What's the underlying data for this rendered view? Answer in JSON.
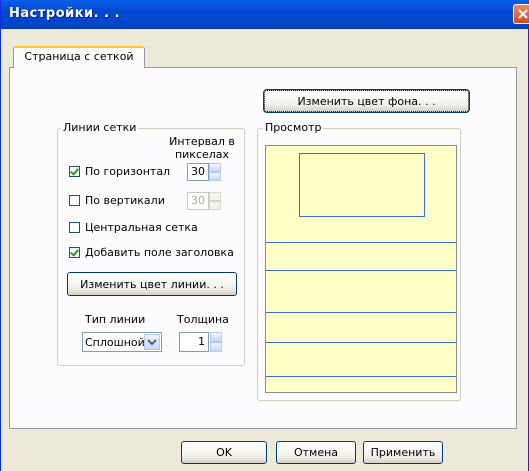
{
  "window": {
    "title": "Настройки. . ."
  },
  "tabs": [
    {
      "label": "Страница с сеткой"
    }
  ],
  "background_button": {
    "label": "Изменить цвет фона. . ."
  },
  "grid_lines": {
    "group_label": "Линии сетки",
    "interval_label": "Интервал в пикселах",
    "horizontal": {
      "label": "По горизонтал",
      "checked": true,
      "value": "30"
    },
    "vertical": {
      "label": "По вертикали",
      "checked": false,
      "value": "30"
    },
    "central_grid": {
      "label": "Центральная сетка",
      "checked": false
    },
    "header_field": {
      "label": "Добавить поле заголовка",
      "checked": true
    },
    "line_color_button": "Изменить цвет линии. . .",
    "line_type": {
      "label": "Тип линии",
      "selected": "Сплошной"
    },
    "thickness": {
      "label": "Толщина",
      "value": "1"
    }
  },
  "preview": {
    "group_label": "Просмотр",
    "background_color": "#ffffc6",
    "line_color": "#3b6fe0"
  },
  "footer": {
    "ok": "OK",
    "cancel": "Отмена",
    "apply": "Применить"
  },
  "colors": {
    "titlebar": "#0046c8",
    "dialog_bg": "#ece9d8",
    "panel_bg": "#fcfcfe"
  }
}
